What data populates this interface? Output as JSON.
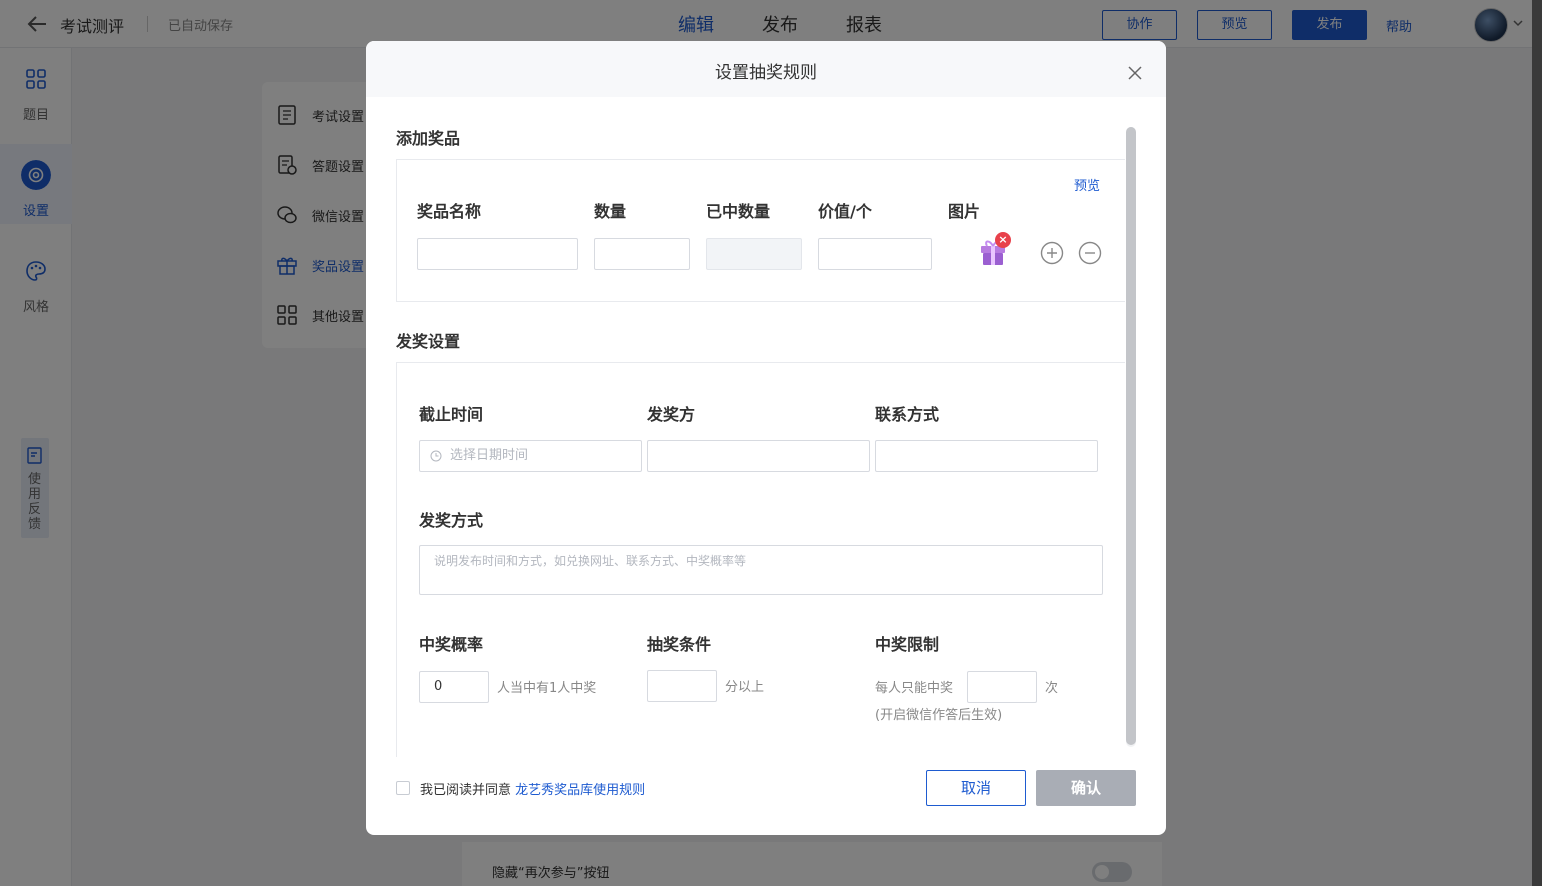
{
  "header": {
    "back_icon": "arrow-left-icon",
    "app_title": "考试测评",
    "save_status": "已自动保存",
    "tabs": [
      {
        "label": "编辑",
        "active": true
      },
      {
        "label": "发布",
        "active": false
      },
      {
        "label": "报表",
        "active": false
      }
    ],
    "collaborate_label": "协作",
    "preview_label": "预览",
    "publish_label": "发布",
    "help_label": "帮助",
    "accent_color": "#1e5bd0"
  },
  "sidebar": {
    "items": [
      {
        "label": "题目",
        "icon": "grid-icon",
        "active": false
      },
      {
        "label": "设置",
        "icon": "gear-icon",
        "active": true
      },
      {
        "label": "风格",
        "icon": "palette-icon",
        "active": false
      }
    ],
    "feedback_label": "使用反馈"
  },
  "submenu": {
    "items": [
      {
        "label": "考试设置",
        "icon": "exam-icon",
        "active": false
      },
      {
        "label": "答题设置",
        "icon": "answer-icon",
        "active": false
      },
      {
        "label": "微信设置",
        "icon": "wechat-icon",
        "active": false
      },
      {
        "label": "奖品设置",
        "icon": "gift-icon",
        "active": true
      },
      {
        "label": "其他设置",
        "icon": "grid-icon",
        "active": false
      }
    ]
  },
  "background_row": {
    "label": "隐藏“再次参与”按钮"
  },
  "modal": {
    "title": "设置抽奖规则",
    "add_prize": {
      "section_title": "添加奖品",
      "preview_link": "预览",
      "columns": [
        "奖品名称",
        "数量",
        "已中数量",
        "价值/个",
        "图片"
      ],
      "row": {
        "name": "",
        "quantity": "",
        "won": "",
        "value": "",
        "image": "gift-box-image"
      },
      "add_icon": "plus-circle-icon",
      "remove_icon": "minus-circle-icon"
    },
    "award_settings": {
      "section_title": "发奖设置",
      "deadline_label": "截止时间",
      "deadline_placeholder": "选择日期时间",
      "issuer_label": "发奖方",
      "contact_label": "联系方式",
      "method_label": "发奖方式",
      "method_placeholder": "说明发布时间和方式，如兑换网址、联系方式、中奖概率等",
      "probability_label": "中奖概率",
      "probability_value": "0",
      "probability_suffix": "人当中有1人中奖",
      "condition_label": "抽奖条件",
      "condition_suffix": "分以上",
      "limit_label": "中奖限制",
      "limit_prefix": "每人只能中奖",
      "limit_suffix": "次",
      "limit_note": "(开启微信作答后生效)"
    },
    "footer": {
      "agree_text": "我已阅读并同意",
      "agree_link": "龙艺秀奖品库使用规则",
      "cancel_label": "取消",
      "confirm_label": "确认"
    }
  }
}
